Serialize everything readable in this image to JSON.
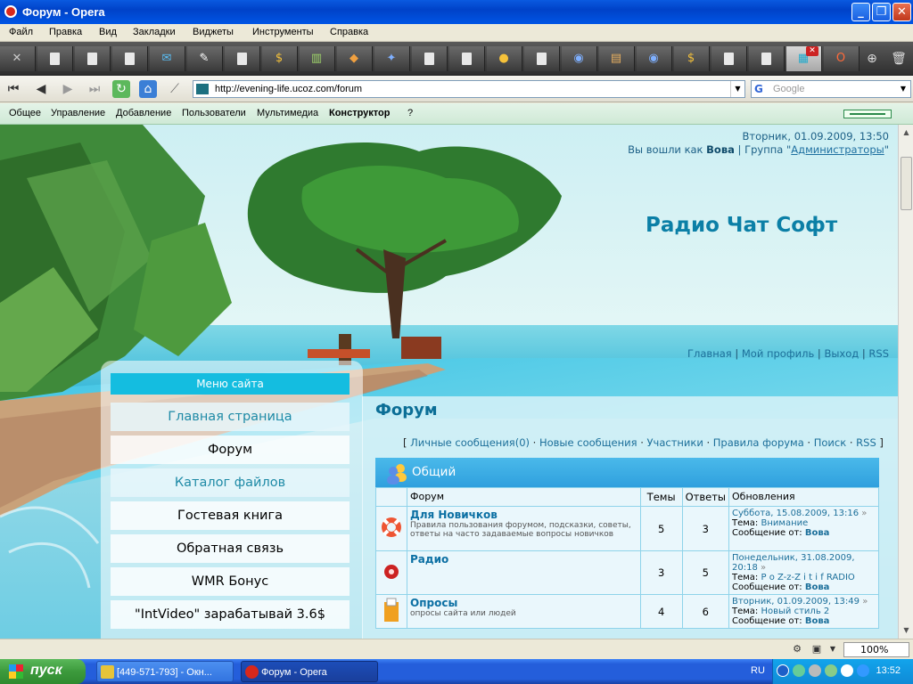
{
  "window": {
    "title": "Форум - Opera",
    "controls": {
      "minimize": "_",
      "maximize": "❐",
      "close": "✕"
    }
  },
  "menubar": [
    "Файл",
    "Правка",
    "Вид",
    "Закладки",
    "Виджеты",
    "Инструменты",
    "Справка"
  ],
  "tabs": [
    {
      "icon": "wrench-icon"
    },
    {
      "icon": "page-icon"
    },
    {
      "icon": "page-icon"
    },
    {
      "icon": "page-icon"
    },
    {
      "icon": "mail-icon"
    },
    {
      "icon": "notepad-icon"
    },
    {
      "icon": "page-icon"
    },
    {
      "icon": "dollar-icon"
    },
    {
      "icon": "chart-icon"
    },
    {
      "icon": "note-icon"
    },
    {
      "icon": "people-icon"
    },
    {
      "icon": "page-icon"
    },
    {
      "icon": "page-icon"
    },
    {
      "icon": "coin-icon"
    },
    {
      "icon": "page-icon"
    },
    {
      "icon": "badge-icon"
    },
    {
      "icon": "package-icon"
    },
    {
      "icon": "badge-icon"
    },
    {
      "icon": "dollar-icon"
    },
    {
      "icon": "page-icon"
    },
    {
      "icon": "page-icon"
    },
    {
      "icon": "site-icon",
      "active": true
    },
    {
      "icon": "opera-icon"
    }
  ],
  "address": {
    "url": "http://evening-life.ucoz.com/forum",
    "search_placeholder": "Google"
  },
  "ucozbar": {
    "items": [
      "Общее",
      "Управление",
      "Добавление",
      "Пользователи",
      "Мультимедиа",
      "Конструктор",
      "?"
    ]
  },
  "header": {
    "datetime": "Вторник, 01.09.2009, 13:50",
    "logged_in_prefix": "Вы вошли как",
    "user": "Вова",
    "group_prefix": "Группа",
    "group": "Администраторы",
    "site_title": "Радио Чат Софт"
  },
  "toplinks": [
    "Главная",
    "Мой профиль",
    "Выход",
    "RSS"
  ],
  "site_menu": {
    "title": "Меню сайта",
    "items": [
      {
        "label": "Главная страница",
        "alt": true
      },
      {
        "label": "Форум",
        "alt": false
      },
      {
        "label": "Каталог файлов",
        "alt": true
      },
      {
        "label": "Гостевая книга",
        "alt": false
      },
      {
        "label": "Обратная связь",
        "alt": false
      },
      {
        "label": "WMR Бонус",
        "alt": false
      },
      {
        "label": "\"IntVideo\" зарабатывай 3.6$",
        "alt": false
      }
    ]
  },
  "forum": {
    "title": "Форум",
    "links": [
      "Личные сообщения(0)",
      "Новые сообщения",
      "Участники",
      "Правила форума",
      "Поиск",
      "RSS"
    ],
    "category": "Общий",
    "columns": [
      "Форум",
      "Темы",
      "Ответы",
      "Обновления"
    ],
    "rows": [
      {
        "name": "Для Новичков",
        "desc": "Правила пользования форумом, подсказки, советы, ответы на часто задаваемые вопросы новичков",
        "topics": "5",
        "replies": "3",
        "date": "Суббота, 15.08.2009, 13:16",
        "topic_label": "Тема:",
        "topic": "Внимание",
        "from_label": "Сообщение от:",
        "author": "Вова",
        "icon": "lifebuoy-icon"
      },
      {
        "name": "Радио",
        "desc": "",
        "topics": "3",
        "replies": "5",
        "date": "Понедельник, 31.08.2009, 20:18",
        "topic_label": "Тема:",
        "topic": "P o Z-z-Z i t i f RADIO",
        "from_label": "Сообщение от:",
        "author": "Вова",
        "icon": "radio-icon"
      },
      {
        "name": "Опросы",
        "desc": "опросы сайта или людей",
        "topics": "4",
        "replies": "6",
        "date": "Вторник, 01.09.2009, 13:49",
        "topic_label": "Тема:",
        "topic": "Новый стиль 2",
        "from_label": "Сообщение от:",
        "author": "Вова",
        "icon": "ballot-box-icon"
      }
    ]
  },
  "statusbar": {
    "zoom": "100%"
  },
  "taskbar": {
    "start": "пуск",
    "windows": [
      {
        "label": "[449-571-793] - Окн...",
        "icon": "icq-icon"
      },
      {
        "label": "Форум - Opera",
        "icon": "opera-icon",
        "active": true
      }
    ],
    "lang": "RU",
    "clock": "13:52"
  },
  "colors": {
    "accent": "#0b7fa6",
    "menu_header": "#14bde0",
    "forum_header": "#2fa0de"
  }
}
